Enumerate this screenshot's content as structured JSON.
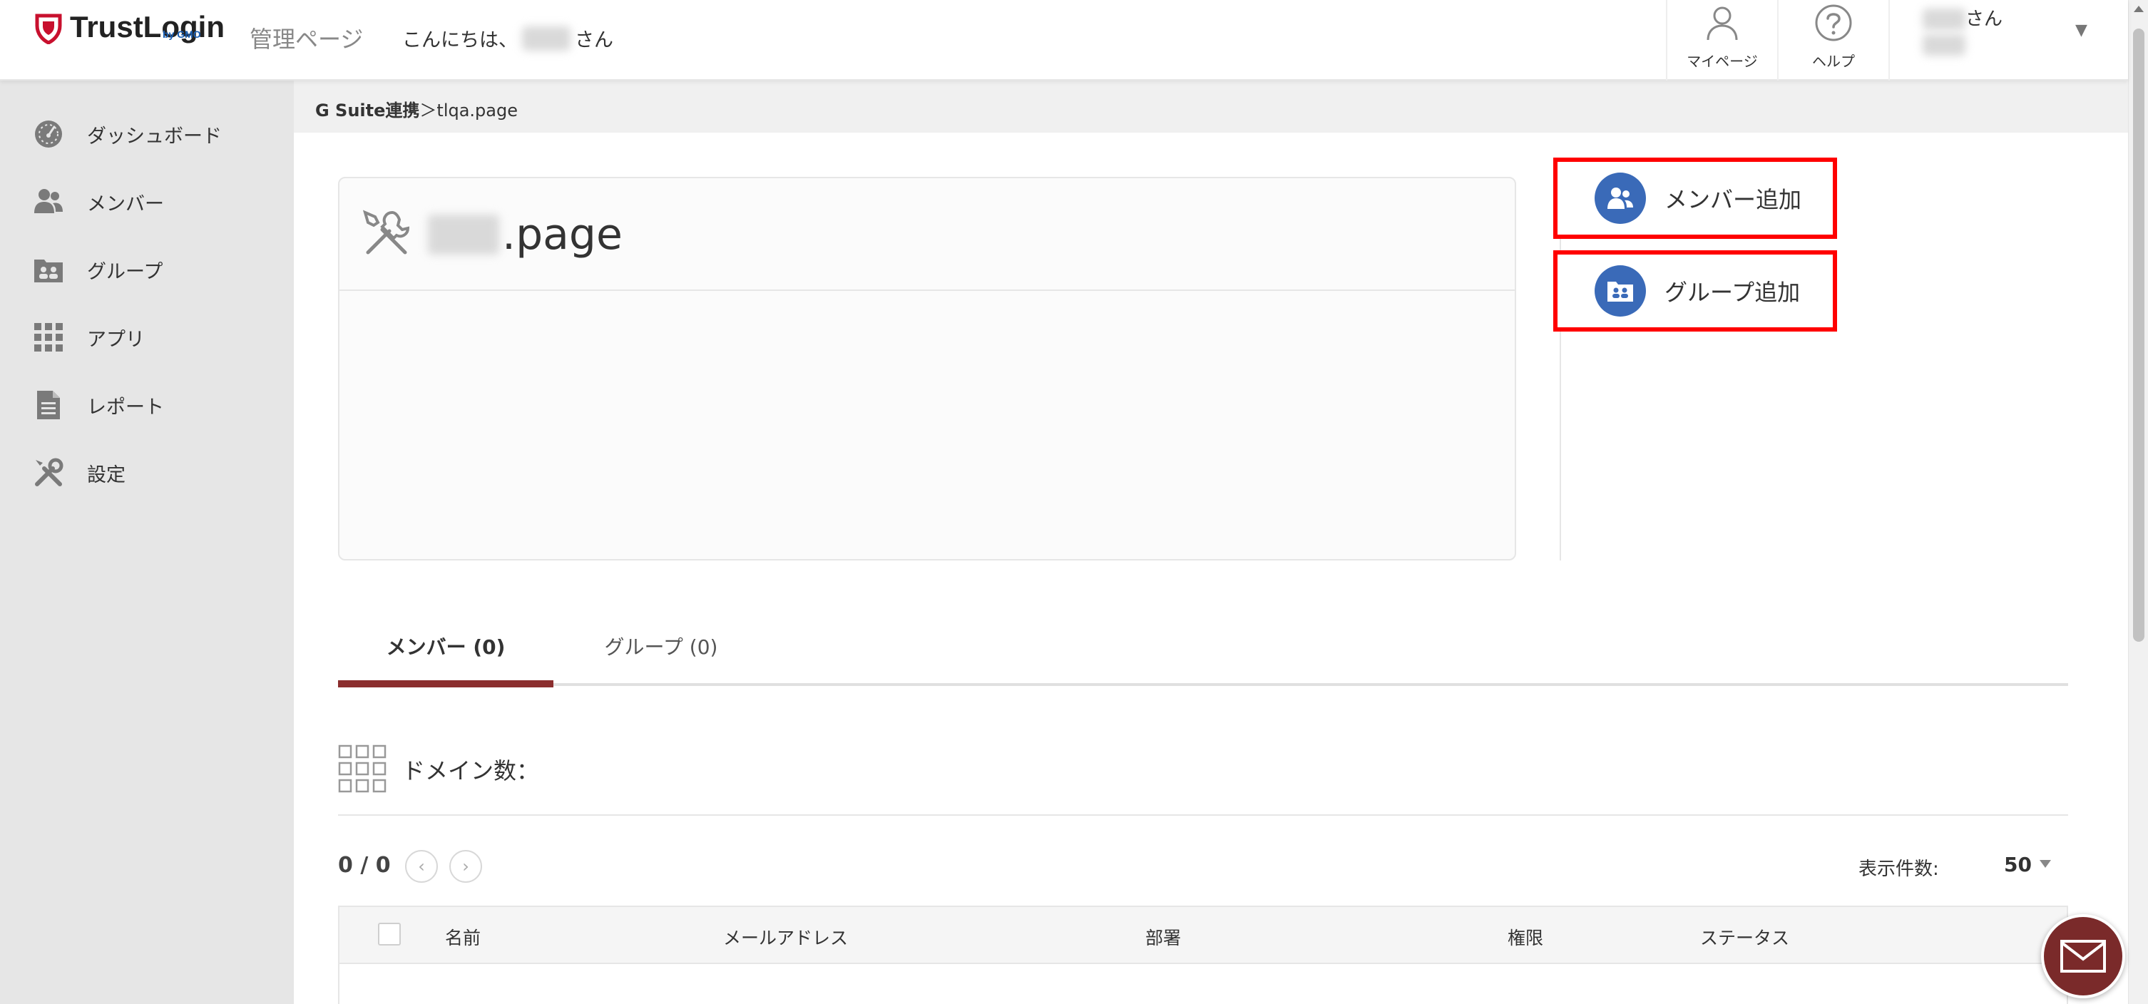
{
  "header": {
    "logo_text": "TrustLogin",
    "logo_sub": "by GMO",
    "admin_title": "管理ページ",
    "greeting_prefix": "こんにちは、",
    "greeting_suffix": "さん",
    "mypage_label": "マイページ",
    "help_label": "ヘルプ",
    "user_suffix": "さん"
  },
  "sidebar": {
    "items": [
      {
        "label": "ダッシュボード",
        "icon": "dashboard-icon"
      },
      {
        "label": "メンバー",
        "icon": "members-icon"
      },
      {
        "label": "グループ",
        "icon": "group-icon"
      },
      {
        "label": "アプリ",
        "icon": "apps-grid-icon"
      },
      {
        "label": "レポート",
        "icon": "report-icon"
      },
      {
        "label": "設定",
        "icon": "tools-icon"
      }
    ]
  },
  "breadcrumb": {
    "parent": "G Suite連携",
    "separator": "＞",
    "current": "tlqa.page"
  },
  "panel": {
    "title_suffix": ".page"
  },
  "actions": {
    "add_member": "メンバー追加",
    "add_group": "グループ追加"
  },
  "tabs": [
    {
      "label": "メンバー (0)",
      "active": true
    },
    {
      "label": "グループ (0)",
      "active": false
    }
  ],
  "domain": {
    "label": "ドメイン数："
  },
  "pager": {
    "count": "0 / 0",
    "prev": "‹",
    "next": "›",
    "per_page_label": "表示件数:",
    "per_page_value": "50"
  },
  "table": {
    "columns": [
      "名前",
      "メールアドレス",
      "部署",
      "権限",
      "ステータス"
    ]
  },
  "colors": {
    "accent": "#8b2e2e",
    "action_icon_bg": "#3a6ab8",
    "highlight_border": "#ff0000",
    "sidebar_bg": "#e6e6e6"
  }
}
